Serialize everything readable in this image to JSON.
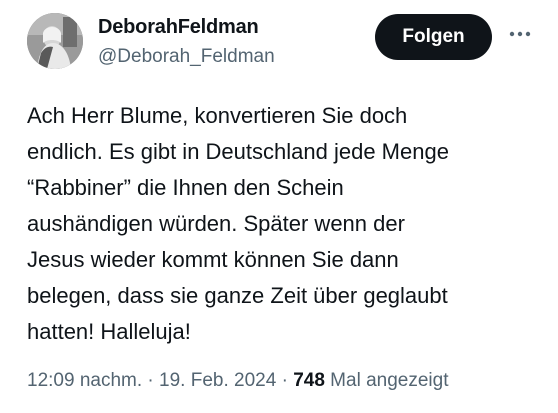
{
  "author": {
    "display_name": "DeborahFeldman",
    "handle": "@Deborah_Feldman",
    "avatar_icon": "profile-photo"
  },
  "actions": {
    "follow_label": "Folgen",
    "more_icon": "more-horizontal-icon"
  },
  "tweet": {
    "text": "Ach Herr Blume, konvertieren Sie doch\nendlich. Es gibt in Deutschland jede Menge\n“Rabbiner” die Ihnen den Schein\naushändigen würden. Später wenn der\nJesus wieder kommt können Sie dann\nbelegen, dass sie ganze Zeit über geglaubt\nhatten! Halleluja!"
  },
  "meta": {
    "time": "12:09 nachm.",
    "separator": " · ",
    "date": "19. Feb. 2024",
    "views_count": "748",
    "views_label": "Mal angezeigt"
  },
  "colors": {
    "text_primary": "#0f1419",
    "text_secondary": "#536471",
    "button_bg": "#0f1419",
    "background": "#ffffff"
  }
}
